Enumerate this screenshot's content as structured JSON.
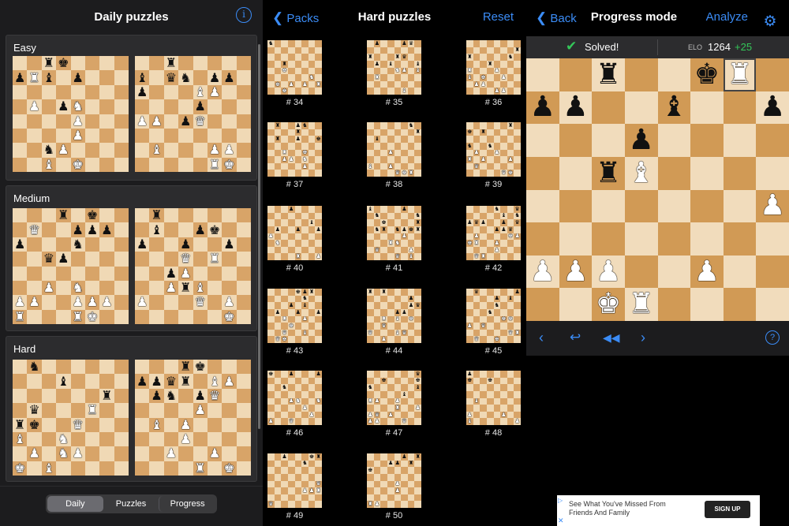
{
  "daily": {
    "title": "Daily puzzles",
    "sections": [
      {
        "label": "Easy",
        "boards": [
          {
            "pieces": [
              [
                0,
                2,
                "r",
                0
              ],
              [
                0,
                3,
                "k",
                0
              ],
              [
                1,
                0,
                "p",
                0
              ],
              [
                1,
                1,
                "R",
                1
              ],
              [
                1,
                2,
                "b",
                0
              ],
              [
                1,
                4,
                "p",
                0
              ],
              [
                3,
                1,
                "P",
                1
              ],
              [
                3,
                3,
                "p",
                0
              ],
              [
                3,
                4,
                "N",
                1
              ],
              [
                4,
                4,
                "P",
                1
              ],
              [
                5,
                4,
                "P",
                1
              ],
              [
                6,
                2,
                "n",
                0
              ],
              [
                6,
                3,
                "P",
                1
              ],
              [
                7,
                2,
                "B",
                1
              ],
              [
                7,
                4,
                "K",
                1
              ]
            ]
          },
          {
            "pieces": [
              [
                0,
                2,
                "r",
                0
              ],
              [
                1,
                0,
                "b",
                0
              ],
              [
                1,
                2,
                "q",
                0
              ],
              [
                1,
                3,
                "n",
                0
              ],
              [
                1,
                5,
                "p",
                0
              ],
              [
                1,
                6,
                "p",
                0
              ],
              [
                2,
                0,
                "p",
                0
              ],
              [
                2,
                4,
                "B",
                1
              ],
              [
                2,
                5,
                "P",
                1
              ],
              [
                3,
                4,
                "p",
                0
              ],
              [
                4,
                0,
                "P",
                1
              ],
              [
                4,
                1,
                "P",
                1
              ],
              [
                4,
                3,
                "p",
                0
              ],
              [
                4,
                4,
                "Q",
                1
              ],
              [
                6,
                1,
                "B",
                1
              ],
              [
                6,
                5,
                "P",
                1
              ],
              [
                6,
                6,
                "P",
                1
              ],
              [
                7,
                5,
                "R",
                1
              ],
              [
                7,
                6,
                "K",
                1
              ]
            ]
          }
        ]
      },
      {
        "label": "Medium",
        "boards": [
          {
            "pieces": [
              [
                0,
                3,
                "r",
                0
              ],
              [
                0,
                5,
                "k",
                0
              ],
              [
                1,
                1,
                "Q",
                1
              ],
              [
                1,
                4,
                "p",
                0
              ],
              [
                1,
                5,
                "p",
                0
              ],
              [
                1,
                6,
                "p",
                0
              ],
              [
                2,
                0,
                "p",
                0
              ],
              [
                2,
                4,
                "n",
                0
              ],
              [
                3,
                2,
                "q",
                0
              ],
              [
                3,
                3,
                "p",
                0
              ],
              [
                5,
                2,
                "P",
                1
              ],
              [
                5,
                4,
                "N",
                1
              ],
              [
                6,
                0,
                "P",
                1
              ],
              [
                6,
                1,
                "P",
                1
              ],
              [
                6,
                4,
                "P",
                1
              ],
              [
                6,
                5,
                "P",
                1
              ],
              [
                6,
                6,
                "P",
                1
              ],
              [
                7,
                0,
                "R",
                1
              ],
              [
                7,
                4,
                "R",
                1
              ],
              [
                7,
                5,
                "K",
                1
              ]
            ]
          },
          {
            "pieces": [
              [
                0,
                1,
                "r",
                0
              ],
              [
                1,
                1,
                "b",
                0
              ],
              [
                1,
                4,
                "p",
                0
              ],
              [
                1,
                5,
                "k",
                0
              ],
              [
                2,
                0,
                "p",
                0
              ],
              [
                2,
                3,
                "p",
                0
              ],
              [
                2,
                6,
                "p",
                0
              ],
              [
                3,
                3,
                "Q",
                1
              ],
              [
                3,
                5,
                "R",
                1
              ],
              [
                4,
                2,
                "p",
                0
              ],
              [
                4,
                3,
                "P",
                1
              ],
              [
                5,
                2,
                "P",
                1
              ],
              [
                5,
                3,
                "r",
                0
              ],
              [
                5,
                4,
                "B",
                1
              ],
              [
                6,
                0,
                "P",
                1
              ],
              [
                6,
                4,
                "Q",
                1
              ],
              [
                6,
                6,
                "P",
                1
              ],
              [
                7,
                6,
                "K",
                1
              ]
            ]
          }
        ]
      },
      {
        "label": "Hard",
        "boards": [
          {
            "pieces": [
              [
                0,
                1,
                "n",
                0
              ],
              [
                1,
                3,
                "b",
                0
              ],
              [
                2,
                6,
                "r",
                0
              ],
              [
                3,
                1,
                "q",
                0
              ],
              [
                3,
                5,
                "R",
                1
              ],
              [
                4,
                0,
                "r",
                0
              ],
              [
                4,
                1,
                "k",
                0
              ],
              [
                4,
                4,
                "Q",
                1
              ],
              [
                5,
                0,
                "B",
                1
              ],
              [
                5,
                3,
                "N",
                1
              ],
              [
                6,
                1,
                "P",
                1
              ],
              [
                6,
                3,
                "N",
                1
              ],
              [
                6,
                4,
                "P",
                1
              ],
              [
                7,
                0,
                "K",
                1
              ],
              [
                7,
                2,
                "B",
                1
              ]
            ]
          },
          {
            "pieces": [
              [
                0,
                3,
                "r",
                0
              ],
              [
                0,
                4,
                "k",
                0
              ],
              [
                1,
                0,
                "p",
                0
              ],
              [
                1,
                1,
                "p",
                0
              ],
              [
                1,
                2,
                "q",
                0
              ],
              [
                1,
                3,
                "r",
                0
              ],
              [
                1,
                5,
                "B",
                1
              ],
              [
                1,
                6,
                "P",
                1
              ],
              [
                2,
                1,
                "p",
                0
              ],
              [
                2,
                2,
                "n",
                0
              ],
              [
                2,
                4,
                "p",
                0
              ],
              [
                2,
                5,
                "Q",
                1
              ],
              [
                3,
                4,
                "P",
                1
              ],
              [
                4,
                1,
                "B",
                1
              ],
              [
                4,
                3,
                "P",
                1
              ],
              [
                5,
                3,
                "P",
                1
              ],
              [
                6,
                2,
                "P",
                1
              ],
              [
                6,
                5,
                "P",
                1
              ],
              [
                7,
                4,
                "R",
                1
              ],
              [
                7,
                6,
                "K",
                1
              ]
            ]
          }
        ]
      }
    ],
    "tabs": [
      "Daily",
      "Puzzles",
      "Progress"
    ],
    "active_tab": "Daily"
  },
  "pack": {
    "back_label": "Packs",
    "title": "Hard puzzles",
    "reset_label": "Reset",
    "puzzles": [
      {
        "label": "# 34",
        "n": 10
      },
      {
        "label": "# 35",
        "n": 15
      },
      {
        "label": "# 36",
        "n": 16
      },
      {
        "label": "# 37",
        "n": 16
      },
      {
        "label": "# 38",
        "n": 9
      },
      {
        "label": "# 39",
        "n": 14
      },
      {
        "label": "# 40",
        "n": 10
      },
      {
        "label": "# 41",
        "n": 22
      },
      {
        "label": "# 42",
        "n": 22
      },
      {
        "label": "# 43",
        "n": 18
      },
      {
        "label": "# 44",
        "n": 18
      },
      {
        "label": "# 45",
        "n": 16
      },
      {
        "label": "# 46",
        "n": 13
      },
      {
        "label": "# 47",
        "n": 18
      },
      {
        "label": "# 48",
        "n": 10
      },
      {
        "label": "# 49",
        "n": 10
      },
      {
        "label": "# 50",
        "n": 10
      }
    ]
  },
  "progress": {
    "back_label": "Back",
    "title": "Progress mode",
    "analyze_label": "Analyze",
    "settings_icon": "gear-icon",
    "status_text": "Solved!",
    "elo_label": "ELO",
    "elo_value": "1264",
    "elo_delta": "+25",
    "board": {
      "pieces": [
        [
          0,
          2,
          "r",
          0
        ],
        [
          0,
          5,
          "k",
          0
        ],
        [
          0,
          6,
          "R",
          1
        ],
        [
          1,
          0,
          "p",
          0
        ],
        [
          1,
          1,
          "p",
          0
        ],
        [
          1,
          4,
          "b",
          0
        ],
        [
          1,
          7,
          "p",
          0
        ],
        [
          2,
          3,
          "p",
          0
        ],
        [
          3,
          2,
          "r",
          0
        ],
        [
          3,
          3,
          "B",
          1
        ],
        [
          4,
          7,
          "P",
          1
        ],
        [
          6,
          0,
          "P",
          1
        ],
        [
          6,
          1,
          "P",
          1
        ],
        [
          6,
          2,
          "P",
          1
        ],
        [
          6,
          5,
          "P",
          1
        ],
        [
          7,
          2,
          "K",
          1
        ],
        [
          7,
          3,
          "R",
          1
        ]
      ]
    },
    "help_icon": "question-icon"
  },
  "ad": {
    "text": "See What You've Missed From Friends And Family",
    "cta": "SIGN UP"
  },
  "colors": {
    "accent": "#3b8cf6",
    "success": "#34c759",
    "light_square": "#f0d9b5",
    "dark_square": "#d8a468"
  }
}
